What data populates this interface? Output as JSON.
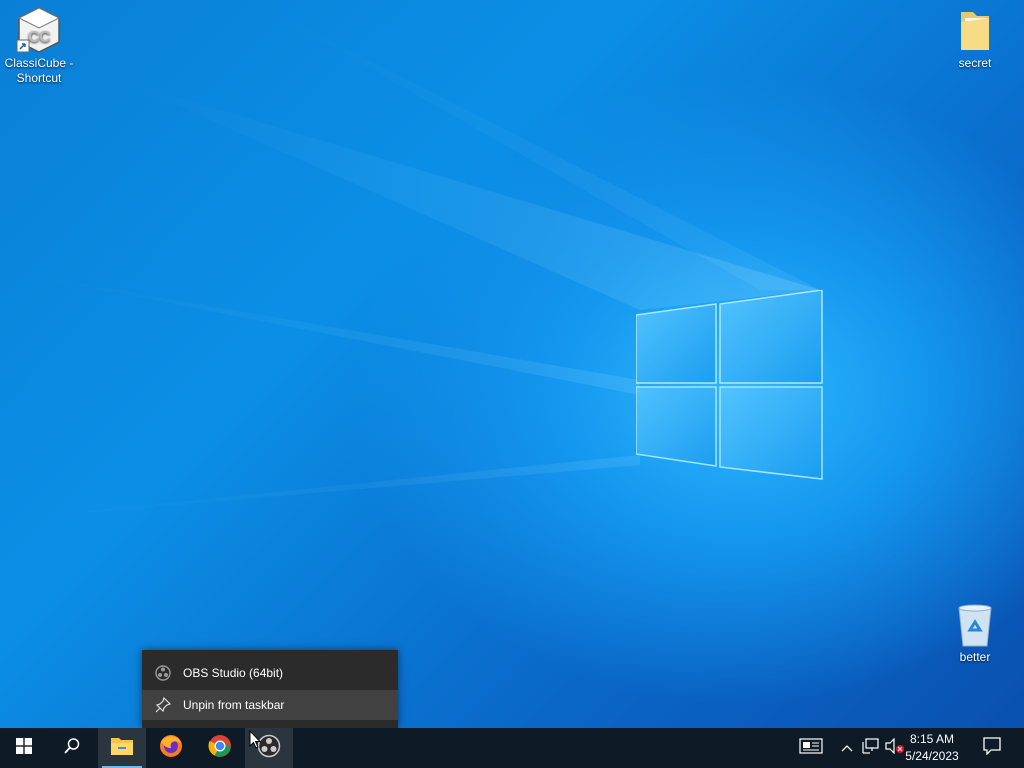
{
  "desktop": {
    "icons": [
      {
        "label": "ClassiCube - Shortcut",
        "icon": "classicube-shortcut-icon"
      },
      {
        "label": "secret",
        "icon": "folder-icon"
      },
      {
        "label": "better",
        "icon": "recycle-bin-icon"
      }
    ]
  },
  "context_menu": {
    "items": [
      {
        "label": "OBS Studio (64bit)",
        "icon": "obs-icon"
      },
      {
        "label": "Unpin from taskbar",
        "icon": "unpin-icon"
      }
    ]
  },
  "taskbar": {
    "apps": [
      "start-icon",
      "search-icon",
      "file-explorer-icon",
      "firefox-icon",
      "chrome-icon",
      "obs-icon"
    ],
    "tray": {
      "time": "8:15 AM",
      "date": "5/24/2023"
    }
  },
  "colors": {
    "accent": "#76b9ed",
    "taskbar": "#0e1a26",
    "menu": "#2b2b2b",
    "menu_hover": "#414141"
  }
}
